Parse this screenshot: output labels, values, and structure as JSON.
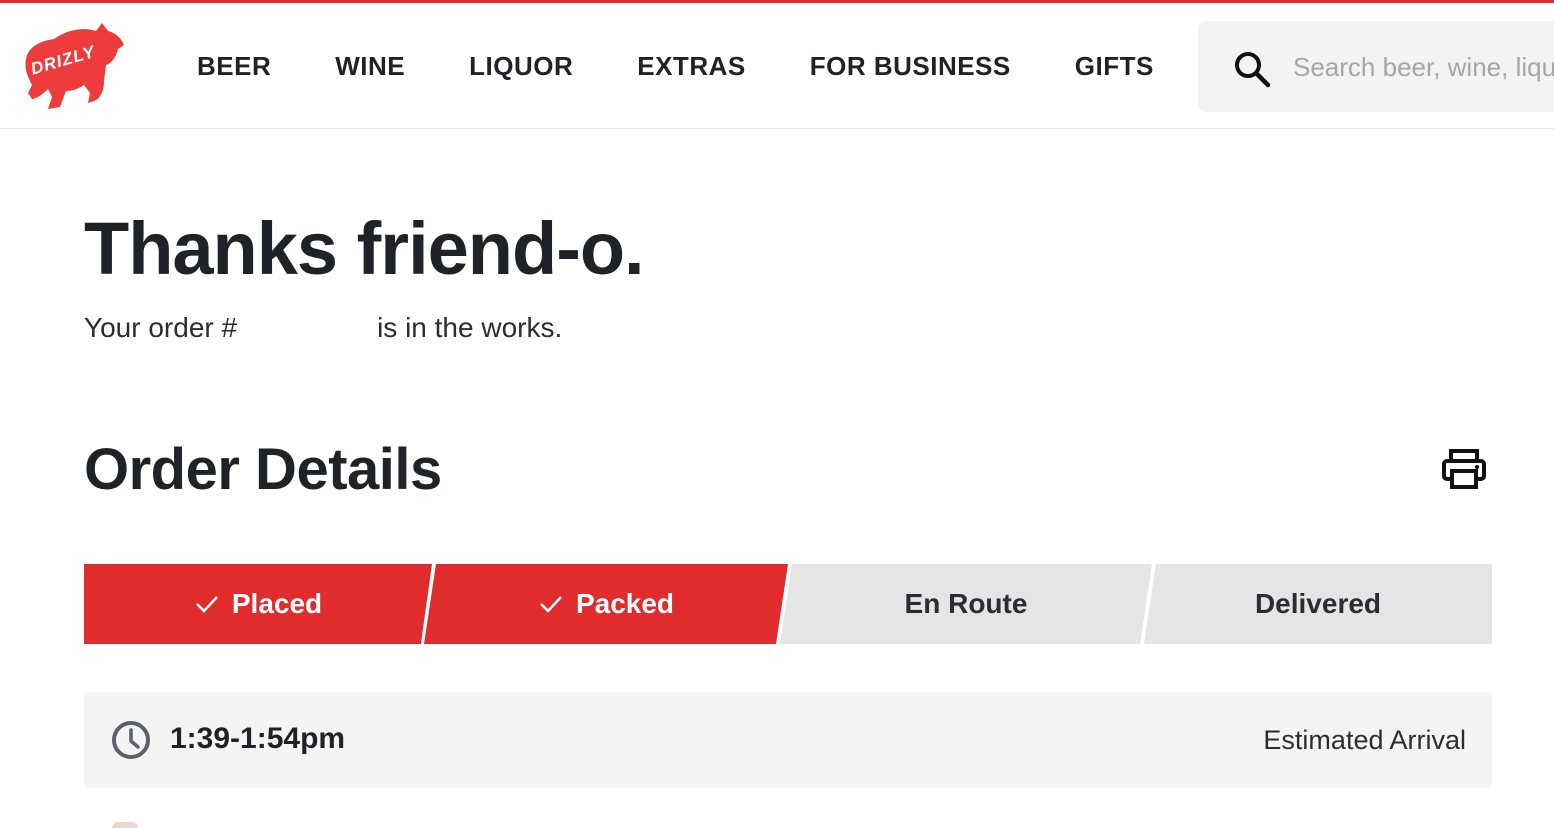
{
  "brand": {
    "logo_text": "DRIZLY",
    "logo_icon": "bear-logo-icon",
    "accent_color": "#e02c2c"
  },
  "nav": {
    "items": [
      {
        "label": "BEER"
      },
      {
        "label": "WINE"
      },
      {
        "label": "LIQUOR"
      },
      {
        "label": "EXTRAS"
      },
      {
        "label": "FOR BUSINESS"
      },
      {
        "label": "GIFTS"
      }
    ]
  },
  "search": {
    "icon": "search-icon",
    "placeholder": "Search beer, wine, liquor",
    "value": ""
  },
  "confirmation": {
    "heading": "Thanks friend-o.",
    "order_prefix": "Your order #",
    "order_suffix": "is in the works."
  },
  "order_details": {
    "title": "Order Details",
    "print_icon": "print-icon",
    "steps": [
      {
        "label": "Placed",
        "status": "complete"
      },
      {
        "label": "Packed",
        "status": "complete"
      },
      {
        "label": "En Route",
        "status": "pending"
      },
      {
        "label": "Delivered",
        "status": "pending"
      }
    ],
    "status_colors": {
      "complete": "#e02c2c",
      "pending": "#e4e5e7"
    }
  },
  "eta": {
    "icon": "clock-icon",
    "time": "1:39-1:54pm",
    "label": "Estimated Arrival"
  }
}
